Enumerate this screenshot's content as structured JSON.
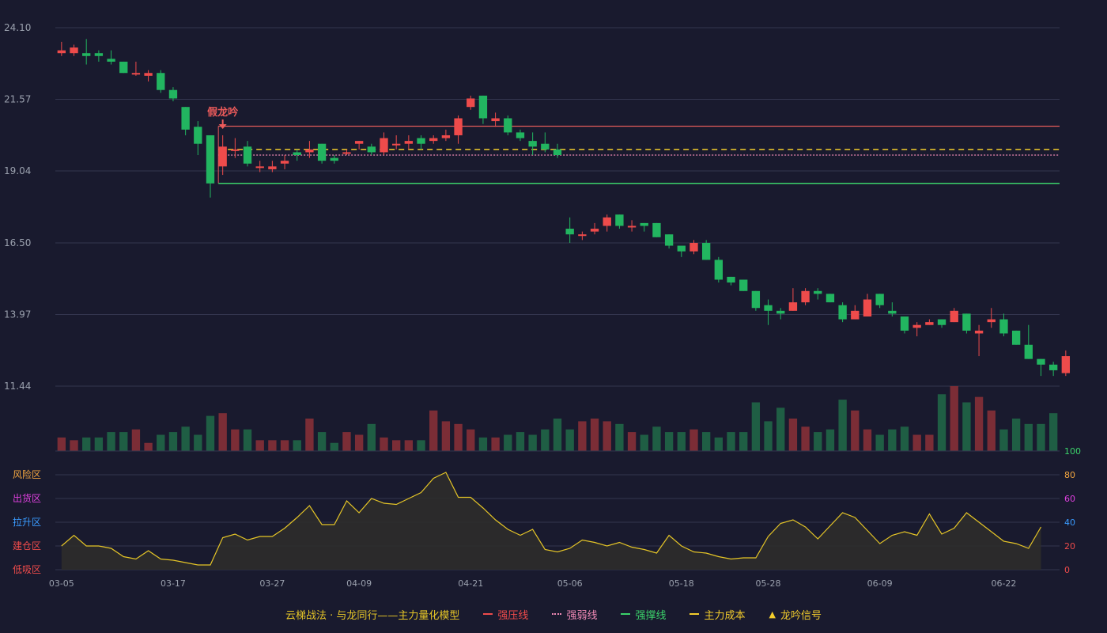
{
  "colors": {
    "background": "#191a2e",
    "up": "#ee4b4b",
    "down": "#22b560",
    "vol_up": "#7b2d36",
    "vol_down": "#1f5e44",
    "grid": "#34364f",
    "axis_text": "#9aa0ad",
    "pressure": "#e05a5a",
    "weak": "#f08ab5",
    "support": "#3bd26a",
    "cost": "#f2cc2c",
    "signal": "#ec5b5b",
    "model_line": "#e5c527",
    "model_fill": "#2e2c2b"
  },
  "chart_data": {
    "type": "candlestick",
    "dates": [
      "03-05",
      "03-06",
      "03-07",
      "03-08",
      "03-11",
      "03-12",
      "03-13",
      "03-14",
      "03-15",
      "03-17",
      "03-18",
      "03-19",
      "03-20",
      "03-21",
      "03-22",
      "03-25",
      "03-26",
      "03-27",
      "03-28",
      "03-29",
      "04-01",
      "04-02",
      "04-03",
      "04-08",
      "04-09",
      "04-10",
      "04-11",
      "04-12",
      "04-15",
      "04-16",
      "04-17",
      "04-18",
      "04-19",
      "04-21",
      "04-22",
      "04-23",
      "04-24",
      "04-25",
      "04-26",
      "04-28",
      "04-29",
      "05-06",
      "05-07",
      "05-08",
      "05-09",
      "05-10",
      "05-13",
      "05-14",
      "05-15",
      "05-16",
      "05-18",
      "05-19",
      "05-20",
      "05-21",
      "05-22",
      "05-23",
      "05-24",
      "05-28",
      "05-29",
      "05-30",
      "05-31",
      "06-03",
      "06-04",
      "06-05",
      "06-06",
      "06-07",
      "06-09",
      "06-10",
      "06-11",
      "06-12",
      "06-13",
      "06-14",
      "06-17",
      "06-18",
      "06-19",
      "06-20",
      "06-22",
      "06-24",
      "06-25",
      "06-26",
      "06-27"
    ],
    "x_tick_labels": [
      "03-05",
      "03-17",
      "03-27",
      "04-09",
      "04-21",
      "05-06",
      "05-18",
      "05-28",
      "06-09",
      "06-22"
    ],
    "price": {
      "y_ticks": [
        "24.10",
        "21.57",
        "19.04",
        "16.50",
        "13.97",
        "11.44"
      ],
      "ylim": [
        11.44,
        24.1
      ],
      "ohlc": [
        [
          23.2,
          23.3,
          23.6,
          23.1
        ],
        [
          23.2,
          23.4,
          23.5,
          23.1
        ],
        [
          23.2,
          23.1,
          23.7,
          22.8
        ],
        [
          23.2,
          23.1,
          23.3,
          22.9
        ],
        [
          23.0,
          22.9,
          23.3,
          22.8
        ],
        [
          22.9,
          22.5,
          22.9,
          22.5
        ],
        [
          22.5,
          22.5,
          22.9,
          22.4
        ],
        [
          22.4,
          22.5,
          22.6,
          22.2
        ],
        [
          22.5,
          21.9,
          22.6,
          21.8
        ],
        [
          21.9,
          21.6,
          22.0,
          21.5
        ],
        [
          21.3,
          20.5,
          21.3,
          20.3
        ],
        [
          20.6,
          20.0,
          20.8,
          19.6
        ],
        [
          20.3,
          18.6,
          20.3,
          18.1
        ],
        [
          19.2,
          19.9,
          20.3,
          18.9
        ],
        [
          19.8,
          19.8,
          20.2,
          19.5
        ],
        [
          19.9,
          19.3,
          20.1,
          19.2
        ],
        [
          19.2,
          19.2,
          19.4,
          19.0
        ],
        [
          19.1,
          19.2,
          19.4,
          19.0
        ],
        [
          19.3,
          19.4,
          19.6,
          19.1
        ],
        [
          19.7,
          19.6,
          19.8,
          19.4
        ],
        [
          19.7,
          19.8,
          20.1,
          19.5
        ],
        [
          20.0,
          19.4,
          20.0,
          19.3
        ],
        [
          19.5,
          19.4,
          19.6,
          19.3
        ],
        [
          19.7,
          19.7,
          19.8,
          19.6
        ],
        [
          20.0,
          20.1,
          20.1,
          19.8
        ],
        [
          19.9,
          19.7,
          20.0,
          19.6
        ],
        [
          19.7,
          20.2,
          20.4,
          19.6
        ],
        [
          20.0,
          20.0,
          20.3,
          19.8
        ],
        [
          20.0,
          20.1,
          20.3,
          19.8
        ],
        [
          20.2,
          20.0,
          20.3,
          19.8
        ],
        [
          20.1,
          20.2,
          20.3,
          20.0
        ],
        [
          20.2,
          20.3,
          20.5,
          20.1
        ],
        [
          20.3,
          20.9,
          21.0,
          20.0
        ],
        [
          21.3,
          21.6,
          21.7,
          21.2
        ],
        [
          21.7,
          20.9,
          21.7,
          20.7
        ],
        [
          20.8,
          20.9,
          21.1,
          20.6
        ],
        [
          20.9,
          20.4,
          21.0,
          20.3
        ],
        [
          20.4,
          20.2,
          20.5,
          20.1
        ],
        [
          20.1,
          19.9,
          20.4,
          19.6
        ],
        [
          20.0,
          19.8,
          20.4,
          19.7
        ],
        [
          19.8,
          19.6,
          20.0,
          19.5
        ],
        [
          17.0,
          16.8,
          17.4,
          16.5
        ],
        [
          16.8,
          16.8,
          16.9,
          16.6
        ],
        [
          16.9,
          17.0,
          17.2,
          16.8
        ],
        [
          17.1,
          17.4,
          17.5,
          16.9
        ],
        [
          17.5,
          17.1,
          17.5,
          17.0
        ],
        [
          17.1,
          17.1,
          17.3,
          16.9
        ],
        [
          17.2,
          17.1,
          17.2,
          16.9
        ],
        [
          17.2,
          16.7,
          17.2,
          16.7
        ],
        [
          16.8,
          16.4,
          16.8,
          16.3
        ],
        [
          16.4,
          16.2,
          16.4,
          16.0
        ],
        [
          16.2,
          16.5,
          16.6,
          16.1
        ],
        [
          16.5,
          15.9,
          16.6,
          15.9
        ],
        [
          15.9,
          15.2,
          16.0,
          15.1
        ],
        [
          15.3,
          15.1,
          15.3,
          15.0
        ],
        [
          15.2,
          14.8,
          15.2,
          14.8
        ],
        [
          14.8,
          14.2,
          14.8,
          14.1
        ],
        [
          14.3,
          14.1,
          14.5,
          13.6
        ],
        [
          14.1,
          14.0,
          14.2,
          13.8
        ],
        [
          14.1,
          14.4,
          14.9,
          14.1
        ],
        [
          14.4,
          14.8,
          14.9,
          14.3
        ],
        [
          14.8,
          14.7,
          14.9,
          14.5
        ],
        [
          14.7,
          14.4,
          14.7,
          14.4
        ],
        [
          14.3,
          13.8,
          14.4,
          13.7
        ],
        [
          13.8,
          14.1,
          14.3,
          13.8
        ],
        [
          13.9,
          14.5,
          14.7,
          13.9
        ],
        [
          14.7,
          14.3,
          14.7,
          14.2
        ],
        [
          14.1,
          14.0,
          14.4,
          13.9
        ],
        [
          13.9,
          13.4,
          13.9,
          13.3
        ],
        [
          13.5,
          13.6,
          13.7,
          13.2
        ],
        [
          13.6,
          13.7,
          13.8,
          13.6
        ],
        [
          13.8,
          13.6,
          13.8,
          13.5
        ],
        [
          13.7,
          14.1,
          14.2,
          13.7
        ],
        [
          14.0,
          13.4,
          14.0,
          13.3
        ],
        [
          13.3,
          13.4,
          13.6,
          12.5
        ],
        [
          13.7,
          13.8,
          14.2,
          13.5
        ],
        [
          13.8,
          13.3,
          14.0,
          13.2
        ],
        [
          13.4,
          12.9,
          13.4,
          12.9
        ],
        [
          12.9,
          12.4,
          13.6,
          12.4
        ],
        [
          12.4,
          12.2,
          12.4,
          11.8
        ],
        [
          12.2,
          12.0,
          12.3,
          11.8
        ],
        [
          11.9,
          12.5,
          12.7,
          11.8
        ]
      ],
      "lines": {
        "pressure": 20.62,
        "cost": 19.8,
        "weak": 19.6,
        "support": 18.6,
        "start_index": 13
      },
      "signal_index": 13,
      "signal_label": "假龙吟"
    },
    "volume": [
      5,
      4,
      5,
      5,
      7,
      7,
      8,
      3,
      6,
      7,
      9,
      6,
      13,
      14,
      8,
      8,
      4,
      4,
      4,
      4,
      12,
      7,
      3,
      7,
      6,
      10,
      5,
      4,
      4,
      4,
      15,
      11,
      10,
      8,
      5,
      5,
      6,
      7,
      6,
      8,
      12,
      8,
      11,
      12,
      11,
      10,
      7,
      6,
      9,
      7,
      7,
      8,
      7,
      5,
      7,
      7,
      18,
      11,
      16,
      12,
      9,
      7,
      8,
      19,
      15,
      8,
      6,
      8,
      9,
      6,
      6,
      21,
      24,
      18,
      20,
      15,
      8,
      12,
      10,
      10,
      14
    ],
    "model": {
      "yticks": [
        "0",
        "20",
        "40",
        "60",
        "80",
        "100"
      ],
      "ylim": [
        0,
        100
      ],
      "zones": [
        "风险区",
        "出货区",
        "拉升区",
        "建仓区",
        "低吸区"
      ],
      "values": [
        20,
        29,
        20,
        20,
        18,
        11,
        9,
        16,
        9,
        8,
        6,
        4,
        4,
        27,
        30,
        25,
        28,
        28,
        35,
        44,
        54,
        38,
        38,
        58,
        48,
        60,
        56,
        55,
        60,
        65,
        77,
        82,
        61,
        61,
        52,
        42,
        34,
        29,
        34,
        17,
        15,
        18,
        25,
        23,
        20,
        23,
        19,
        17,
        14,
        29,
        20,
        15,
        14,
        11,
        9,
        10,
        10,
        28,
        39,
        42,
        36,
        26,
        37,
        48,
        44,
        33,
        22,
        29,
        32,
        29,
        47,
        30,
        35,
        48,
        40,
        32,
        24,
        22,
        18,
        36
      ]
    },
    "legend": [
      {
        "label": "云梯战法 · 与龙同行——主力量化模型",
        "color": "#e5c527",
        "style": "none"
      },
      {
        "label": "强压线",
        "color": "#ee4b4b",
        "style": "solid"
      },
      {
        "label": "强弱线",
        "color": "#f08ab5",
        "style": "dotted"
      },
      {
        "label": "强撑线",
        "color": "#3bd26a",
        "style": "solid"
      },
      {
        "label": "主力成本",
        "color": "#f2cc2c",
        "style": "dashed"
      },
      {
        "label": "龙吟信号",
        "color": "#f2cc2c",
        "style": "triangle"
      }
    ]
  }
}
